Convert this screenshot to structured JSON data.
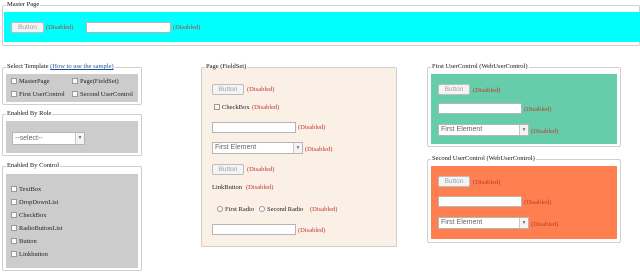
{
  "master": {
    "title": "Master Page",
    "button_label": "Button",
    "disabled_1": "(Disabled)",
    "disabled_2": "(Disabled)",
    "bg_color": "#00ffff"
  },
  "select_template": {
    "legend_prefix": "Select Template",
    "legend_link": "(How to use the sample)",
    "items": [
      {
        "label": "MasterPage",
        "checked": false
      },
      {
        "label": "Page(FieldSet)",
        "checked": false
      },
      {
        "label": "First UserControl",
        "checked": false
      },
      {
        "label": "Second UserControl",
        "checked": false
      }
    ]
  },
  "enabled_by_role": {
    "legend": "Enabled By Role",
    "select_value": "--select--"
  },
  "enabled_by_control": {
    "legend": "Enabled By Control",
    "items": [
      "TextBox",
      "DropDownList",
      "CheckBox",
      "RadioButtonList",
      "Button",
      "Linkbutton"
    ]
  },
  "page_fieldset": {
    "legend": "Page (FieldSet)",
    "bg_color": "#faf0e6",
    "button_label": "Button",
    "checkbox_label": "CheckBox",
    "select_value": "First Element",
    "button2_label": "Button",
    "linkbutton_label": "LinkButton",
    "radio_1": "First Radio",
    "radio_2": "Second Radio",
    "disabled": "(Disabled)"
  },
  "first_uc": {
    "legend": "First UserControl (WebUserControl)",
    "bg_color": "#66cdaa",
    "button_label": "Button",
    "select_value": "First Element",
    "disabled": "(Disabled)"
  },
  "second_uc": {
    "legend": "Second UserControl (WebUserControl)",
    "bg_color": "#ff7f50",
    "button_label": "Button",
    "select_value": "First Element",
    "disabled": "(Disabled)"
  }
}
